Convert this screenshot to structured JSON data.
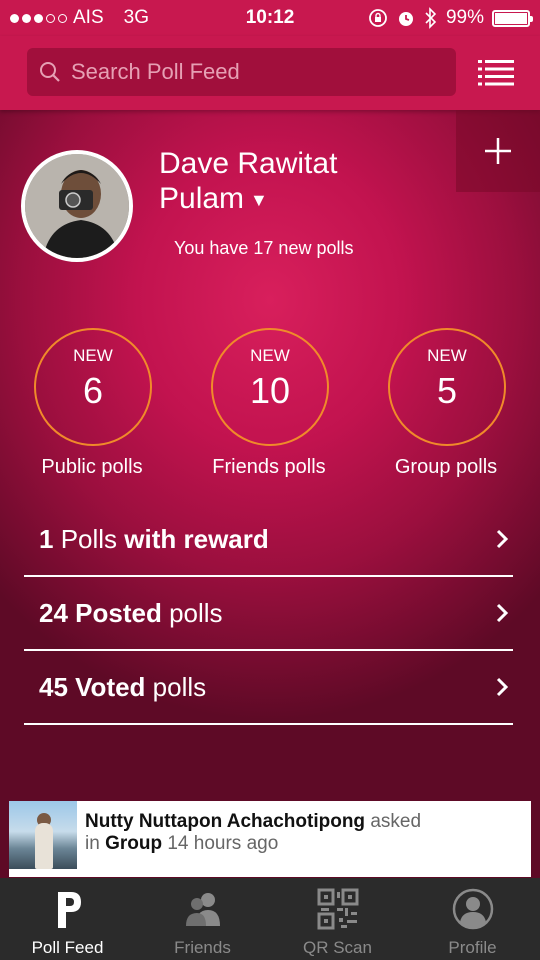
{
  "status_bar": {
    "carrier": "AIS",
    "network": "3G",
    "time": "10:12",
    "battery": "99%",
    "battery_level": 0.99
  },
  "search": {
    "placeholder": "Search Poll Feed"
  },
  "profile": {
    "name": "Dave Rawitat Pulam",
    "caret": "▼",
    "new_polls_message": "You have 17 new polls"
  },
  "counters": [
    {
      "badge": "NEW",
      "count": "6",
      "label": "Public polls"
    },
    {
      "badge": "NEW",
      "count": "10",
      "label": "Friends polls"
    },
    {
      "badge": "NEW",
      "count": "5",
      "label": "Group polls"
    }
  ],
  "poll_rows": [
    {
      "count": "1",
      "text_plain": " Polls ",
      "text_bold": "with reward",
      "text_after": ""
    },
    {
      "count": "24",
      "text_plain": "",
      "text_bold": " Posted",
      "text_after": " polls"
    },
    {
      "count": "45",
      "text_plain": "",
      "text_bold": " Voted",
      "text_after": " polls"
    }
  ],
  "feed": {
    "author": "Nutty Nuttapon Achachotipong",
    "action": " asked",
    "in_text": "in ",
    "group": "Group",
    "time": " 14 hours ago"
  },
  "tabs": [
    {
      "label": "Poll Feed",
      "icon": "poll-feed-icon",
      "active": true
    },
    {
      "label": "Friends",
      "icon": "friends-icon",
      "active": false
    },
    {
      "label": "QR Scan",
      "icon": "qr-code-icon",
      "active": false
    },
    {
      "label": "Profile",
      "icon": "profile-icon",
      "active": false
    }
  ],
  "colors": {
    "brand": "#c8184f",
    "accent_ring": "#f08a2a",
    "tab_bar": "#2b2b2b"
  }
}
